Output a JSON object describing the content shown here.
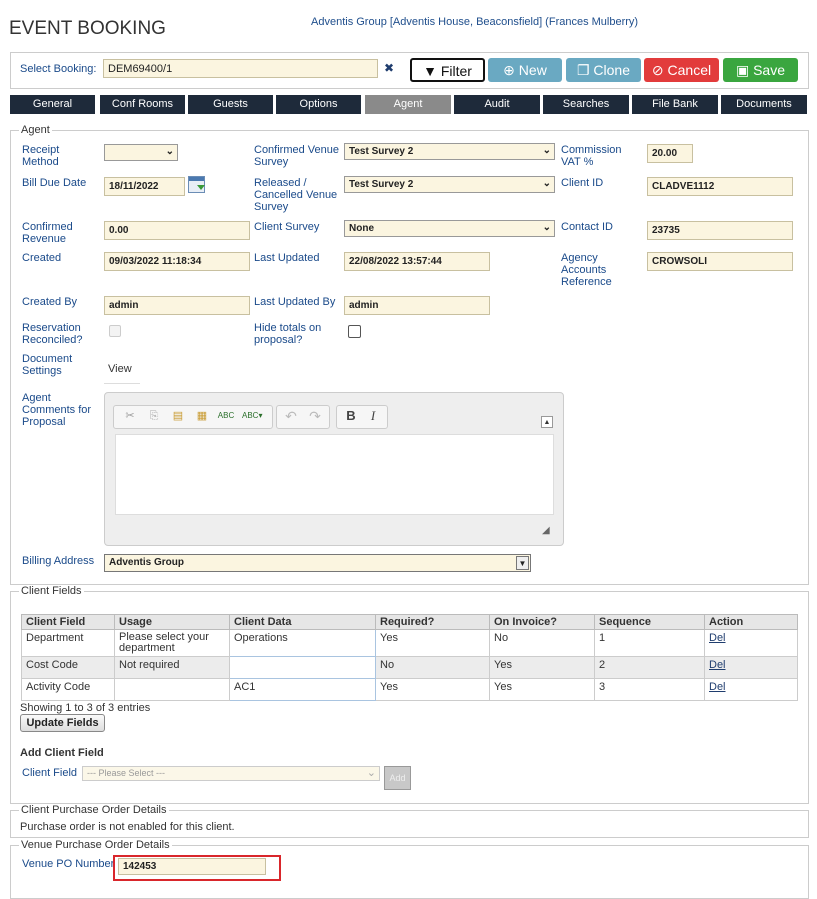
{
  "header": {
    "title": "EVENT BOOKING",
    "org_info": "Adventis Group [Adventis House, Beaconsfield] (Frances Mulberry)"
  },
  "booking": {
    "select_label": "Select Booking:",
    "value": "DEM69400/1",
    "clear_glyph": "✖"
  },
  "toolbar": {
    "filter": "Filter",
    "new": "New",
    "clone": "Clone",
    "cancel": "Cancel",
    "save": "Save"
  },
  "colors": {
    "new": "#6aa9c2",
    "clone": "#6aa9c2",
    "cancel": "#e23b3b",
    "save": "#3aa63f",
    "tab_bg": "#1e2a3a",
    "tab_active": "#8a8a8a"
  },
  "tabs": [
    "General",
    "Conf Rooms",
    "Guests",
    "Options",
    "Agent",
    "Audit",
    "Searches",
    "File Bank",
    "Documents"
  ],
  "active_tab": "Agent",
  "agent": {
    "legend": "Agent",
    "receipt_method_label": "Receipt Method",
    "receipt_method_value": "",
    "confirmed_venue_survey_label": "Confirmed Venue Survey",
    "confirmed_venue_survey_value": "Test Survey 2",
    "commission_vat_label": "Commission VAT %",
    "commission_vat_value": "20.00",
    "bill_due_date_label": "Bill Due Date",
    "bill_due_date_value": "18/11/2022",
    "released_survey_label": "Released / Cancelled Venue Survey",
    "released_survey_value": "Test Survey 2",
    "client_id_label": "Client ID",
    "client_id_value": "CLADVE1112",
    "confirmed_revenue_label": "Confirmed Revenue",
    "confirmed_revenue_value": "0.00",
    "client_survey_label": "Client Survey",
    "client_survey_value": "None",
    "contact_id_label": "Contact ID",
    "contact_id_value": "23735",
    "created_label": "Created",
    "created_value": "09/03/2022 11:18:34",
    "last_updated_label": "Last Updated",
    "last_updated_value": "22/08/2022 13:57:44",
    "agency_ref_label": "Agency Accounts Reference",
    "agency_ref_value": "CROWSOLI",
    "created_by_label": "Created By",
    "created_by_value": "admin",
    "last_updated_by_label": "Last Updated By",
    "last_updated_by_value": "admin",
    "reservation_reconciled_label": "Reservation Reconciled?",
    "hide_totals_label": "Hide totals on proposal?",
    "document_settings_label": "Document Settings",
    "view_link": "View",
    "agent_comments_label": "Agent Comments for Proposal",
    "billing_address_label": "Billing Address",
    "billing_address_value": "Adventis Group"
  },
  "client_fields": {
    "legend": "Client Fields",
    "columns": [
      "Client Field",
      "Usage",
      "Client Data",
      "Required?",
      "On Invoice?",
      "Sequence",
      "Action"
    ],
    "rows": [
      {
        "field": "Department",
        "usage": "Please select your department",
        "data": "Operations",
        "required": "Yes",
        "invoice": "No",
        "sequence": "1",
        "action": "Del"
      },
      {
        "field": "Cost Code",
        "usage": "Not required",
        "data": "",
        "required": "No",
        "invoice": "Yes",
        "sequence": "2",
        "action": "Del"
      },
      {
        "field": "Activity Code",
        "usage": "",
        "data": "AC1",
        "required": "Yes",
        "invoice": "Yes",
        "sequence": "3",
        "action": "Del"
      }
    ],
    "showing": "Showing 1 to 3 of 3 entries",
    "update_button": "Update Fields",
    "add_heading": "Add Client Field",
    "add_label": "Client Field",
    "add_placeholder": "--- Please Select ---",
    "add_button": "Add"
  },
  "client_po": {
    "legend": "Client Purchase Order Details",
    "message": "Purchase order is not enabled for this client."
  },
  "venue_po": {
    "legend": "Venue Purchase Order Details",
    "label": "Venue PO Number",
    "value": "142453"
  }
}
